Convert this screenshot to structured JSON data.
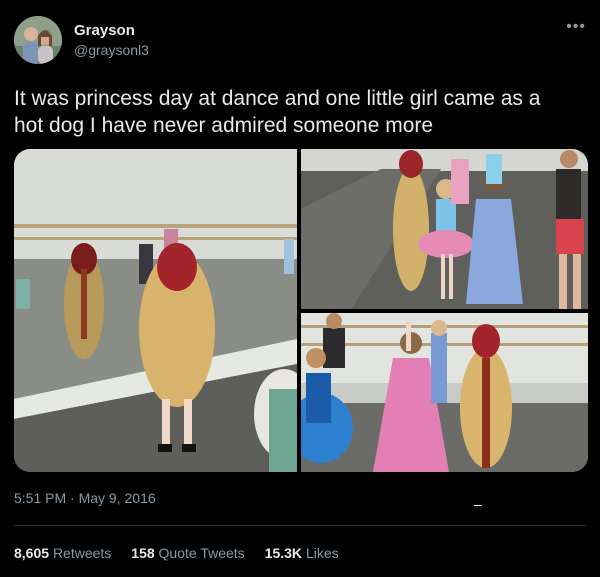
{
  "user": {
    "name": "Grayson",
    "handle": "@graysonl3"
  },
  "tweet": {
    "text": "It was princess day at dance and one little girl came as a hot dog I have never admired someone more",
    "time": "5:51 PM",
    "separator": "·",
    "date": "May 9, 2016"
  },
  "stats": {
    "retweets_count": "8,605",
    "retweets_label": "Retweets",
    "quotes_count": "158",
    "quotes_label": "Quote Tweets",
    "likes_count": "15.3K",
    "likes_label": "Likes"
  },
  "icons": {
    "more": "more-options-icon"
  },
  "colors": {
    "background": "#000000",
    "text": "#e7e9ea",
    "secondary": "#8b98a5",
    "divider": "#2f3336"
  }
}
